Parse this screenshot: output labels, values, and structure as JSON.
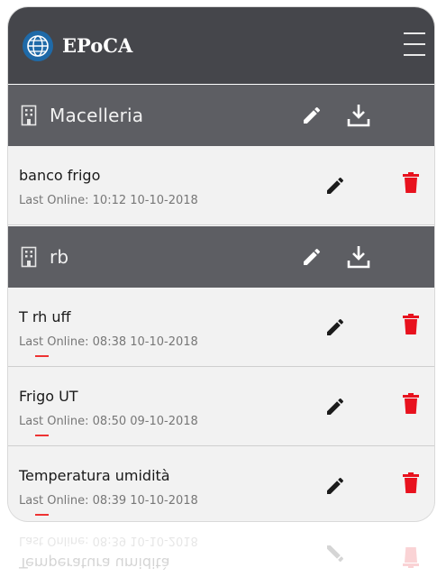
{
  "app": {
    "title": "EPoCA"
  },
  "groups": [
    {
      "name": "Macelleria",
      "devices": [
        {
          "name": "banco frigo",
          "last_online": "Last Online: 10:12 10-10-2018"
        }
      ]
    },
    {
      "name": "rb",
      "devices": [
        {
          "name": "T rh uff",
          "last_online": "Last Online: 08:38 10-10-2018"
        },
        {
          "name": "Frigo UT",
          "last_online": "Last Online: 08:50 09-10-2018"
        },
        {
          "name": "Temperatura umidità",
          "last_online": "Last Online: 08:39 10-10-2018"
        }
      ]
    }
  ],
  "colors": {
    "appbar": "#45464b",
    "group_header": "#5d5e63",
    "delete": "#e8121e",
    "logo": "#1f6aa8"
  }
}
